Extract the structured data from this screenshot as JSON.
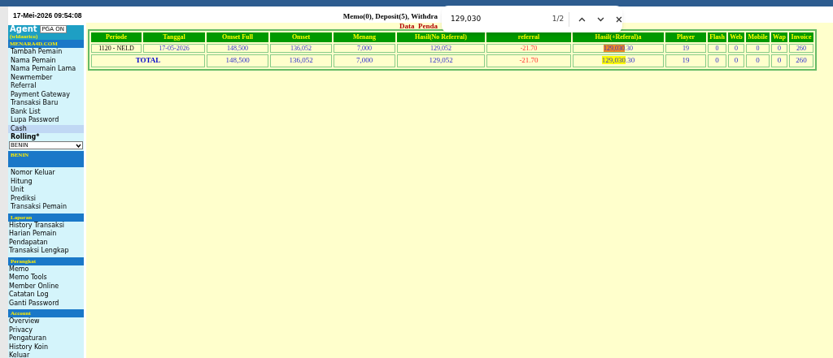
{
  "header": {
    "datetime": "17-Mei-2026 09:54:08",
    "notice": "Memo(0), Deposit(5), Withdra",
    "subtitle": "Data  Penda"
  },
  "sidebar": {
    "agent": {
      "title": "Agent",
      "button": "PGA ON",
      "username": "(wldaarico)",
      "site": "MENARA4D.COM"
    },
    "menu": [
      {
        "label": "Tambah Pemain",
        "selected": false
      },
      {
        "label": "Nama Pemain",
        "selected": false
      },
      {
        "label": "Nama Pemain Lama",
        "selected": false
      },
      {
        "label": "Newmember",
        "selected": false
      },
      {
        "label": "Referral",
        "selected": false
      },
      {
        "label": "Payment Gateway",
        "selected": false
      },
      {
        "label": "Transaksi Baru",
        "selected": false
      },
      {
        "label": "Bank List",
        "selected": false
      },
      {
        "label": "Lupa Password",
        "selected": false
      },
      {
        "label": "Cash",
        "selected": true
      }
    ],
    "rolling": {
      "label": "Rolling*",
      "value": "BENIN"
    },
    "sections": [
      {
        "title": "BENIN",
        "indented": true,
        "items": [
          "Nomor Keluar",
          "Hitung",
          "Unit",
          "Prediksi",
          "Transaksi Pemain"
        ]
      },
      {
        "title": "Laporan",
        "indented": false,
        "items": [
          "History Transaksi",
          "Harian Pemain",
          "Pendapatan",
          "Transaksi Lengkap"
        ]
      },
      {
        "title": "Perangkat",
        "indented": false,
        "items": [
          "Memo",
          "Memo Tools",
          "Member Online",
          "Catatan Log",
          "Ganti Password"
        ]
      },
      {
        "title": "Account",
        "indented": false,
        "items": [
          "Overview",
          "Privacy",
          "Pengaturan",
          "History Koin",
          "Keluar"
        ]
      }
    ]
  },
  "table": {
    "columns": [
      "Periode",
      "Tanggal",
      "Omset Full",
      "Omset",
      "Menang",
      "Hasil(No Referral)",
      "referral",
      "Hasil(+Referal)a",
      "Player",
      "Flash",
      "Web",
      "Mobile",
      "Wap",
      "Invoice"
    ],
    "rows": [
      {
        "periode": "1120 - NELD",
        "tanggal": "17-05-2026",
        "omset_full": "148,500",
        "omset": "136,052",
        "menang": "7,000",
        "hasil_no_ref": "129,052",
        "referral": "-21.70",
        "hasil_ref": {
          "match": "129,030",
          "rest": ".30",
          "current": true
        },
        "player": "19",
        "flash": "0",
        "web": "0",
        "mobile": "0",
        "wap": "0",
        "invoice": "260"
      }
    ],
    "total": {
      "label": "TOTAL",
      "omset_full": "148,500",
      "omset": "136,052",
      "menang": "7,000",
      "hasil_no_ref": "129,052",
      "referral": "-21.70",
      "hasil_ref": {
        "match": "129,030",
        "rest": ".30",
        "current": false
      },
      "player": "19",
      "flash": "0",
      "web": "0",
      "mobile": "0",
      "wap": "0",
      "invoice": "260"
    }
  },
  "find_bar": {
    "query": "129,030",
    "count": "1/2"
  }
}
